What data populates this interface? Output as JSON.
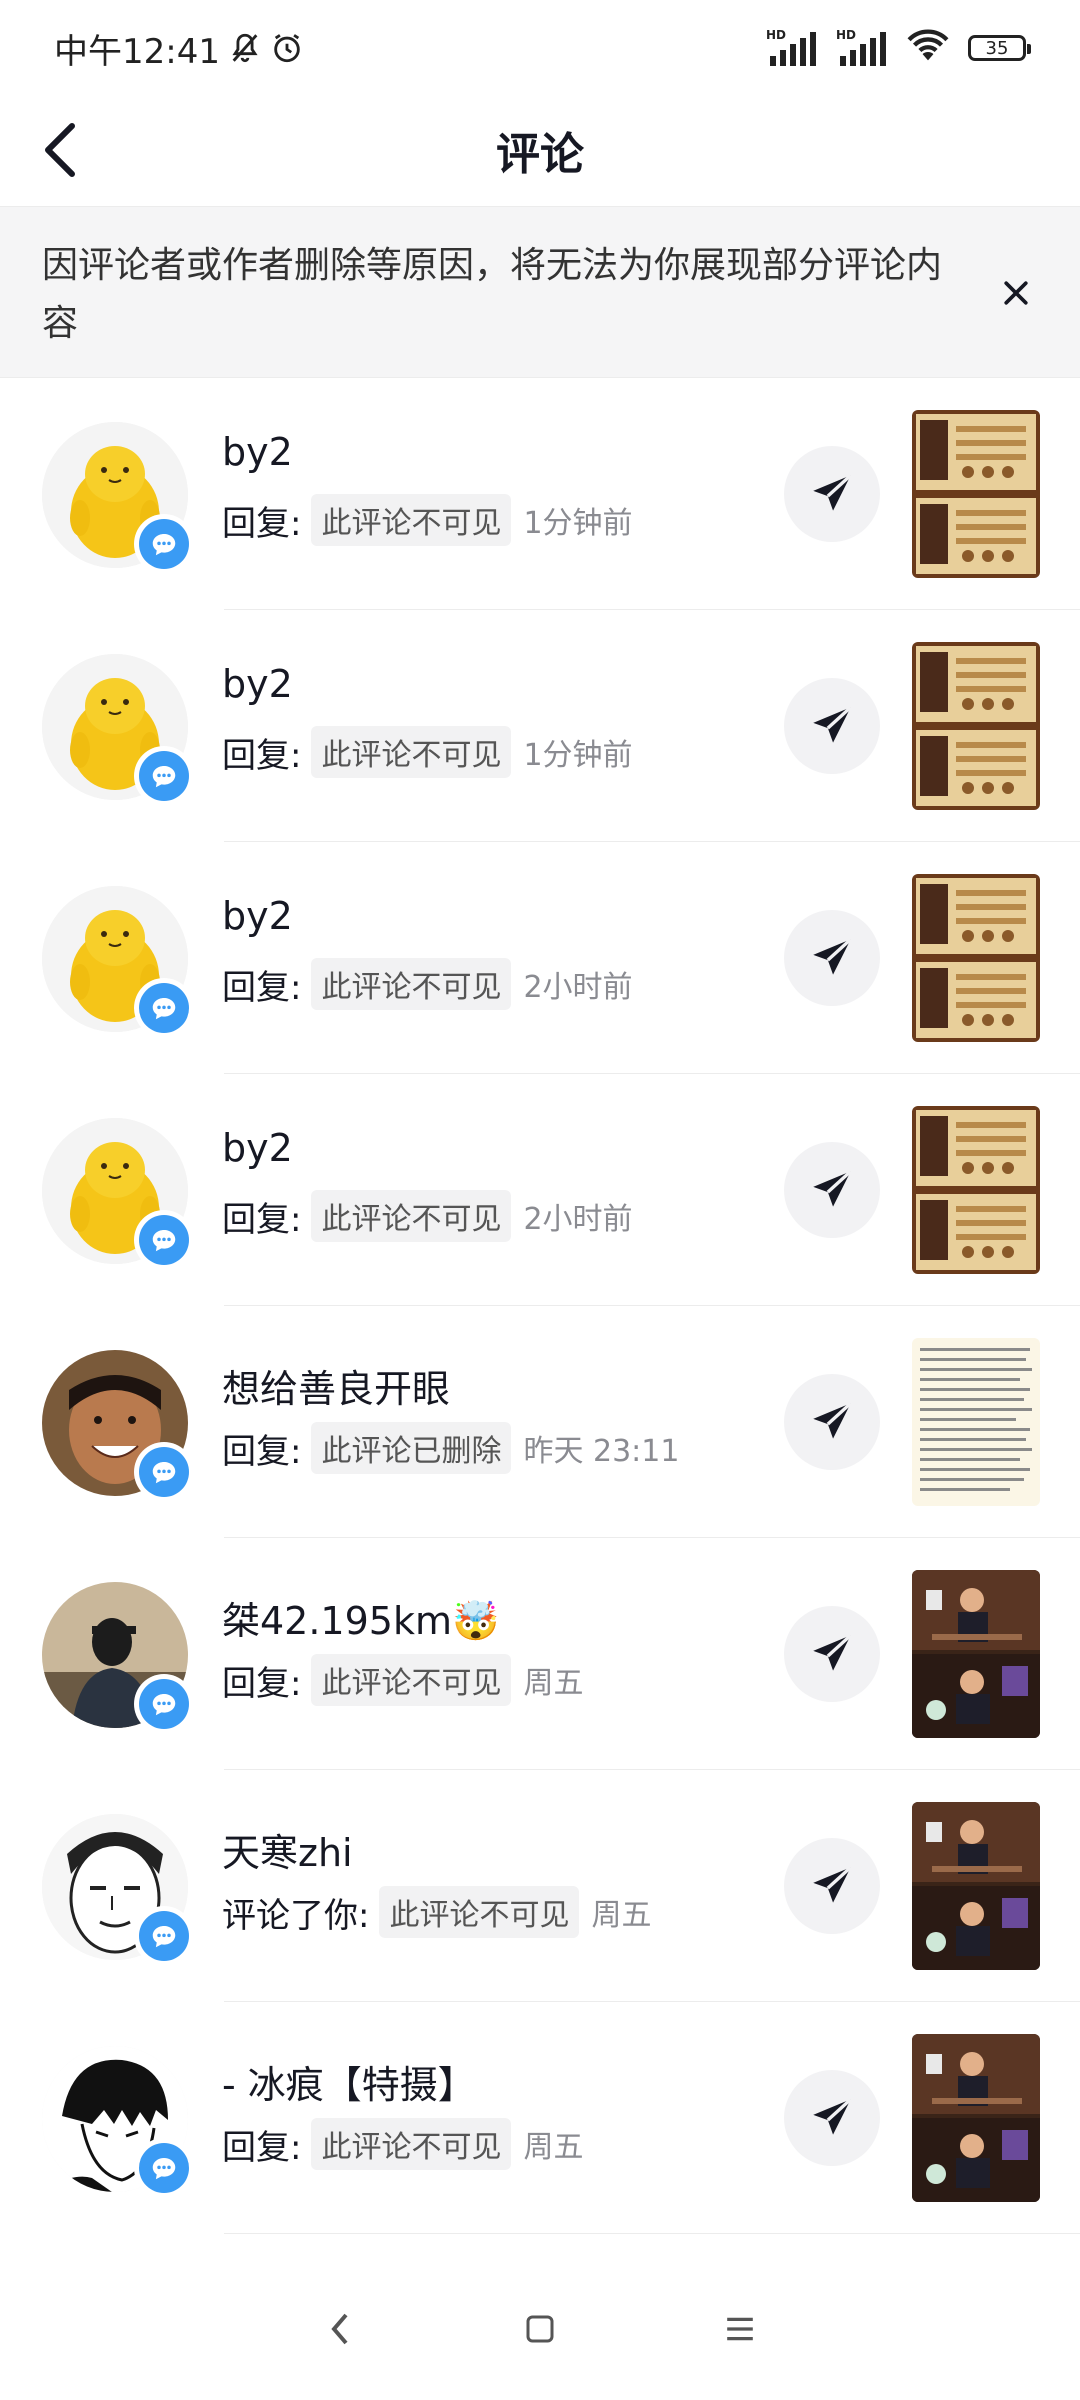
{
  "status_bar": {
    "time": "中午12:41",
    "battery": "35",
    "signal_label": "HD"
  },
  "header": {
    "title": "评论"
  },
  "notice": {
    "text": "因评论者或作者删除等原因，将无法为你展现部分评论内容"
  },
  "colors": {
    "badge": "#3a9bf4",
    "notice_bg": "#f5f5f6",
    "muted_text": "#8a8b91"
  },
  "notifications": [
    {
      "name": "by2",
      "action": "回复:",
      "comment": "此评论不可见",
      "time": "1分钟前",
      "avatar": "yellow-blob",
      "thumb": "game"
    },
    {
      "name": "by2",
      "action": "回复:",
      "comment": "此评论不可见",
      "time": "1分钟前",
      "avatar": "yellow-blob",
      "thumb": "game"
    },
    {
      "name": "by2",
      "action": "回复:",
      "comment": "此评论不可见",
      "time": "2小时前",
      "avatar": "yellow-blob",
      "thumb": "game"
    },
    {
      "name": "by2",
      "action": "回复:",
      "comment": "此评论不可见",
      "time": "2小时前",
      "avatar": "yellow-blob",
      "thumb": "game"
    },
    {
      "name": "想给善良开眼",
      "action": "回复:",
      "comment": "此评论已删除",
      "time": "昨天 23:11",
      "avatar": "smiling-man",
      "thumb": "text"
    },
    {
      "name": "桀42.195km🤯",
      "action": "回复:",
      "comment": "此评论不可见",
      "time": "周五",
      "avatar": "silhouette",
      "thumb": "video"
    },
    {
      "name": "天寒zhi",
      "action": "评论了你:",
      "comment": "此评论不可见",
      "time": "周五",
      "avatar": "manga-face",
      "thumb": "video"
    },
    {
      "name": "- 冰痕【特摄】",
      "action": "回复:",
      "comment": "此评论不可见",
      "time": "周五",
      "avatar": "anime-boy",
      "thumb": "video"
    }
  ]
}
